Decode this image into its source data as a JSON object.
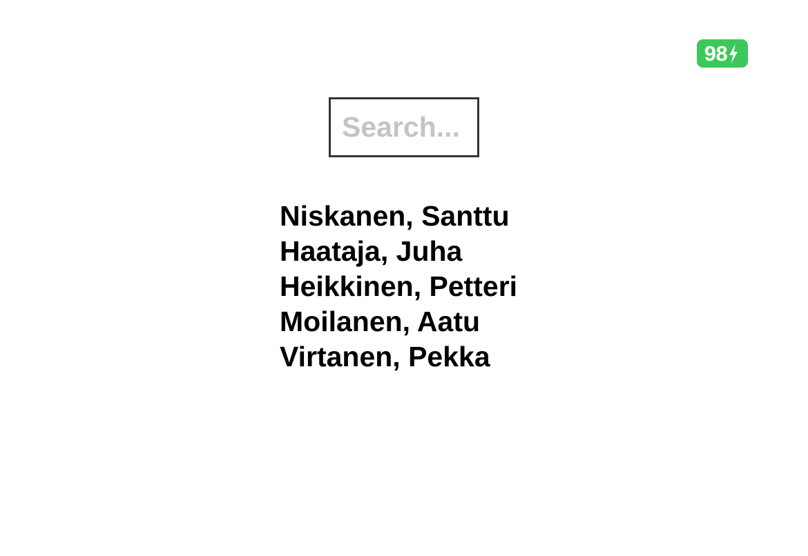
{
  "status": {
    "battery_level": "98",
    "battery_color": "#3cc85a",
    "charging_icon": "bolt-icon"
  },
  "search": {
    "placeholder": "Search...",
    "value": ""
  },
  "people": [
    "Niskanen, Santtu",
    "Haataja, Juha",
    "Heikkinen, Petteri",
    "Moilanen, Aatu",
    "Virtanen, Pekka"
  ]
}
